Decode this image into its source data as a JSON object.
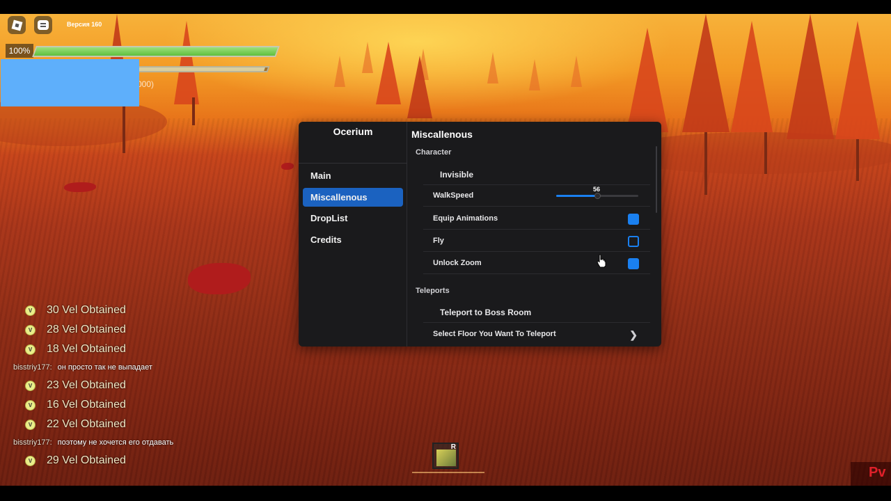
{
  "top_bar": {
    "version_label": "Версия 160",
    "roblox_icon": "roblox-logo-icon",
    "chat_icon": "chat-icon"
  },
  "stats": {
    "health_label": "100%",
    "health_value": 1.0,
    "xp_fraction": 0.98,
    "xp_text_partial": "000)"
  },
  "chat_feed": [
    {
      "type": "vel",
      "text": "30 Vel Obtained"
    },
    {
      "type": "vel",
      "text": "28 Vel Obtained"
    },
    {
      "type": "vel",
      "text": "18 Vel Obtained"
    },
    {
      "type": "msg",
      "user": "bisstriy177:",
      "text": "он просто так не выпадает"
    },
    {
      "type": "vel",
      "text": "23 Vel Obtained"
    },
    {
      "type": "vel",
      "text": "16 Vel Obtained"
    },
    {
      "type": "vel",
      "text": "22 Vel Obtained"
    },
    {
      "type": "msg",
      "user": "bisstriy177:",
      "text": "поэтому не хочется его отдавать"
    },
    {
      "type": "vel",
      "text": "29 Vel Obtained"
    }
  ],
  "hotbar": {
    "key": "R"
  },
  "watermark": {
    "text": "Pv"
  },
  "menu": {
    "title": "Ocerium",
    "tabs": [
      {
        "label": "Main",
        "active": false
      },
      {
        "label": "Miscallenous",
        "active": true
      },
      {
        "label": "DropList",
        "active": false
      },
      {
        "label": "Credits",
        "active": false
      }
    ],
    "page_title": "Miscallenous",
    "character": {
      "section_label": "Character",
      "invisible_label": "Invisible",
      "walkspeed_label": "WalkSpeed",
      "walkspeed_value": "56",
      "walkspeed_fraction": 0.5,
      "equip_animations_label": "Equip Animations",
      "equip_animations_on": true,
      "fly_label": "Fly",
      "fly_on": false,
      "unlock_zoom_label": "Unlock Zoom",
      "unlock_zoom_on": true
    },
    "teleports": {
      "section_label": "Teleports",
      "boss_room_label": "Teleport to Boss Room",
      "select_floor_label": "Select Floor You Want To Teleport"
    }
  },
  "colors": {
    "accent": "#1a80f0",
    "active_tab": "#1b62c0",
    "panel": "#1a1a1c",
    "health_green": "#6fcb4a",
    "overlay_blue": "#5eaffb"
  }
}
